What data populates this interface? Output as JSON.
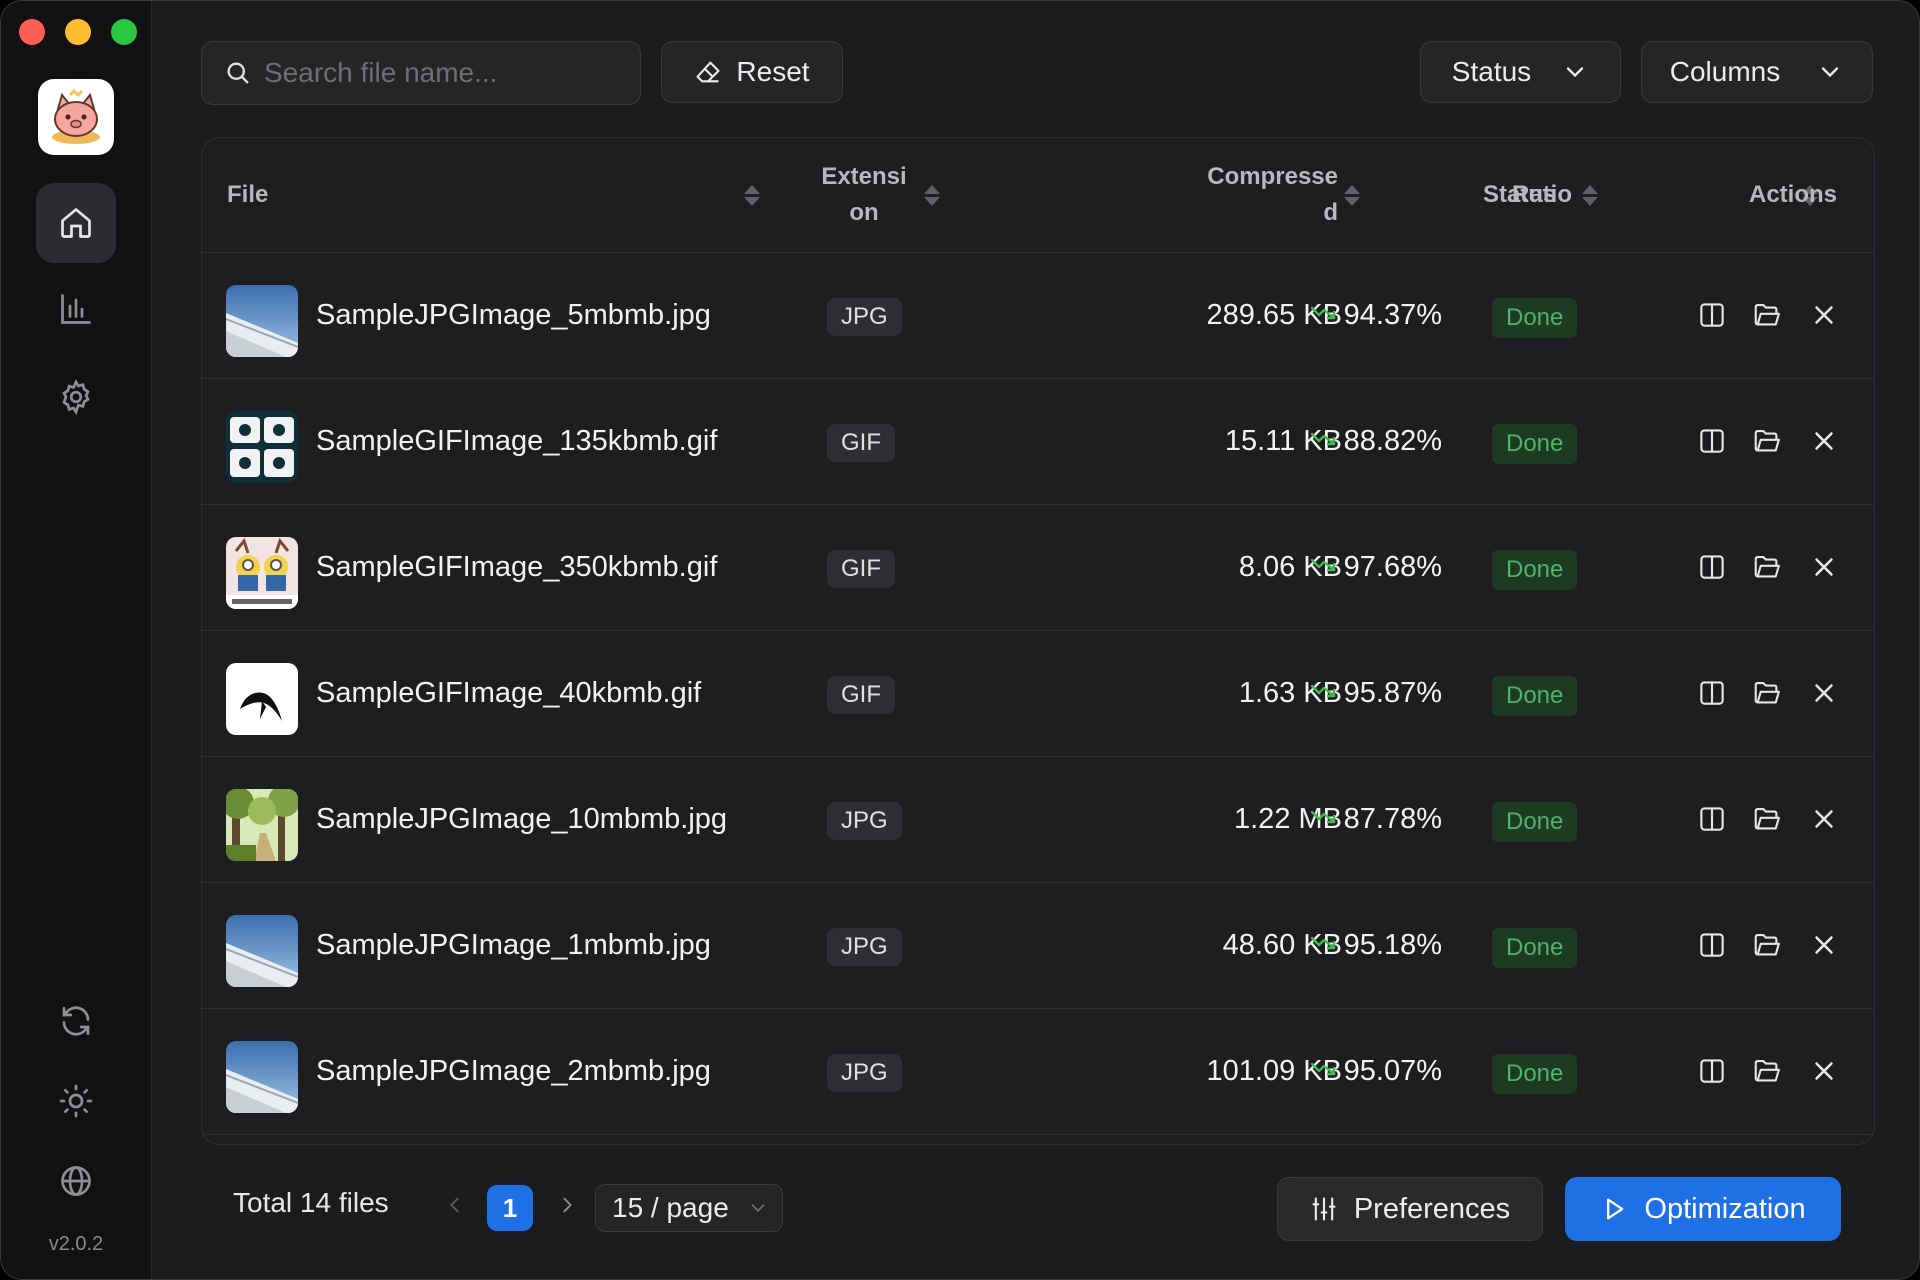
{
  "app": {
    "version": "v2.0.2"
  },
  "toolbar": {
    "search_placeholder": "Search file name...",
    "reset_label": "Reset",
    "status_label": "Status",
    "columns_label": "Columns"
  },
  "table": {
    "headers": {
      "file": "File",
      "extension_line1": "Extensi",
      "extension_line2": "on",
      "compressed_line1": "Compresse",
      "compressed_line2": "d",
      "ratio": "Ratio",
      "status": "Status",
      "actions": "Actions"
    },
    "rows": [
      {
        "name": "SampleJPGImage_5mbmb.jpg",
        "ext": "JPG",
        "size": "289.65 KB",
        "ratio": "94.37%",
        "status": "Done",
        "thumb": "airplane-wing"
      },
      {
        "name": "SampleGIFImage_135kbmb.gif",
        "ext": "GIF",
        "size": "15.11 KB",
        "ratio": "88.82%",
        "status": "Done",
        "thumb": "app-text"
      },
      {
        "name": "SampleGIFImage_350kbmb.gif",
        "ext": "GIF",
        "size": "8.06 KB",
        "ratio": "97.68%",
        "status": "Done",
        "thumb": "christmas-minions"
      },
      {
        "name": "SampleGIFImage_40kbmb.gif",
        "ext": "GIF",
        "size": "1.63 KB",
        "ratio": "95.87%",
        "status": "Done",
        "thumb": "black-bird"
      },
      {
        "name": "SampleJPGImage_10mbmb.jpg",
        "ext": "JPG",
        "size": "1.22 MB",
        "ratio": "87.78%",
        "status": "Done",
        "thumb": "forest-path"
      },
      {
        "name": "SampleJPGImage_1mbmb.jpg",
        "ext": "JPG",
        "size": "48.60 KB",
        "ratio": "95.18%",
        "status": "Done",
        "thumb": "airplane-wing"
      },
      {
        "name": "SampleJPGImage_2mbmb.jpg",
        "ext": "JPG",
        "size": "101.09 KB",
        "ratio": "95.07%",
        "status": "Done",
        "thumb": "airplane-wing"
      }
    ]
  },
  "footer": {
    "total": "Total 14 files",
    "current_page": "1",
    "per_page": "15 / page",
    "preferences_label": "Preferences",
    "optimization_label": "Optimization"
  },
  "colors": {
    "accent": "#1f6fe5",
    "done_text": "#4fb36a",
    "done_bg": "#1d3a23",
    "ratio_arrow": "#3fb950"
  }
}
